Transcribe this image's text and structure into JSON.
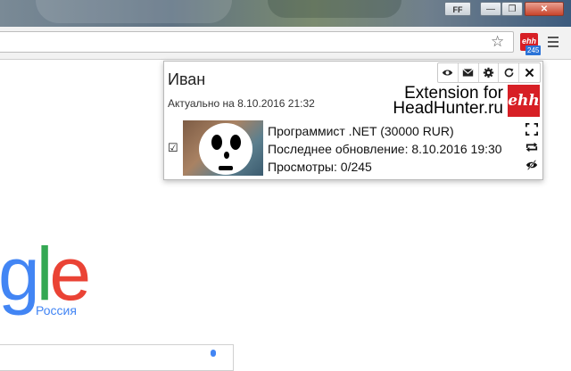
{
  "window": {
    "profile_label": "FF",
    "minimize_glyph": "—",
    "maximize_glyph": "❐",
    "close_glyph": "✕"
  },
  "toolbar": {
    "star_icon": "star-icon",
    "extension_icon_text": "ehh",
    "extension_badge": "245",
    "menu_icon": "hamburger-menu-icon"
  },
  "google": {
    "logo_letters": [
      "g",
      "l",
      "e"
    ],
    "region": "Россия"
  },
  "popup": {
    "name": "Иван",
    "updated": "Актуально на 8.10.2016 21:32",
    "tools": [
      "eye-icon",
      "envelope-icon",
      "gear-icon",
      "refresh-icon",
      "close-icon"
    ],
    "brand_line1": "Extension for",
    "brand_line2": "HeadHunter.ru",
    "brand_logo": "ehh",
    "resume": {
      "checkbox": "☑",
      "title": "Программист .NET (30000 RUR)",
      "last_update": "Последнее обновление: 8.10.2016 19:30",
      "views": "Просмотры: 0/245",
      "icons": [
        "expand-icon",
        "repost-icon",
        "hide-eye-icon"
      ]
    }
  },
  "colors": {
    "brand_red": "#d71f25",
    "badge_blue": "#2a73d8",
    "google_blue": "#4285f4",
    "google_green": "#34a853",
    "google_red": "#ea4335"
  }
}
